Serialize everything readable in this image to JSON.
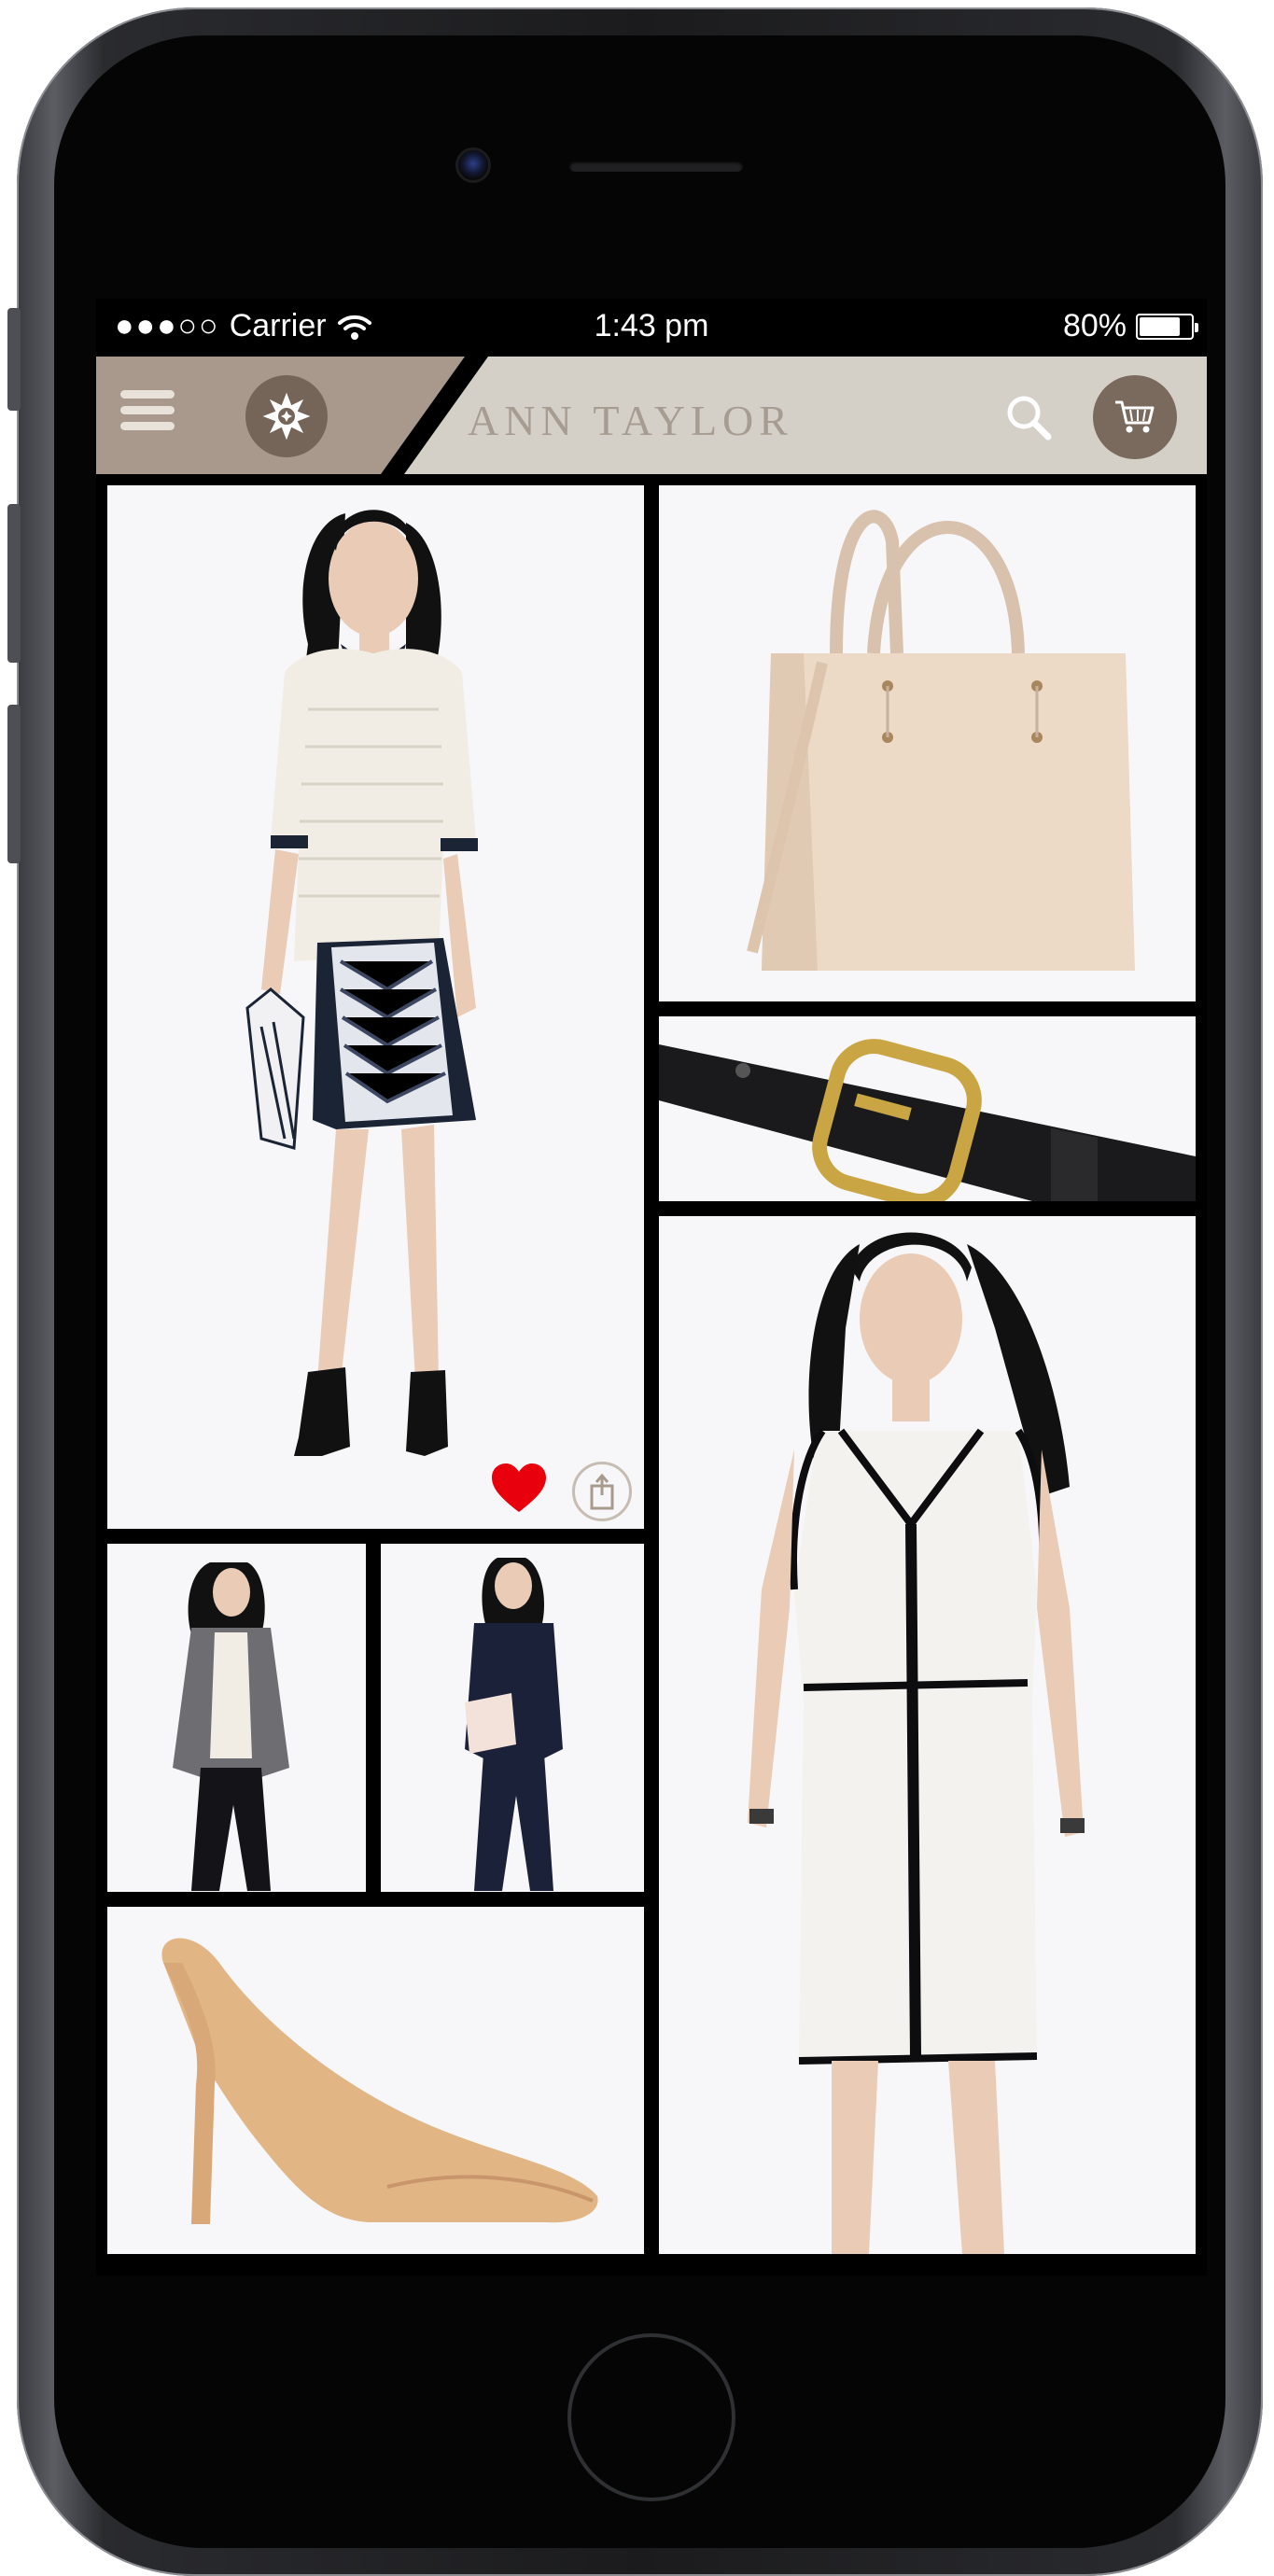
{
  "status_bar": {
    "signal": "●●●○○",
    "carrier": "Carrier",
    "time": "1:43 pm",
    "battery": "80%",
    "battery_level": 0.8
  },
  "nav_bar": {
    "brand": "ANN TAYLOR",
    "menu_icon": "hamburger-menu-icon",
    "feature_icon": "starburst-icon",
    "search_icon": "search-icon",
    "cart_icon": "shopping-cart-icon"
  },
  "grid": {
    "items": [
      {
        "product": "outfit-sweater-skirt"
      },
      {
        "product": "tote-bag"
      },
      {
        "product": "leather-belt"
      },
      {
        "product": "outfit-tweed-jacket"
      },
      {
        "product": "outfit-navy-jumpsuit"
      },
      {
        "product": "nude-heel"
      },
      {
        "product": "white-sheath-dress"
      }
    ]
  },
  "actions": {
    "favorite_icon": "heart-icon",
    "share_icon": "share-icon"
  },
  "colors": {
    "nav_bg": "#d4cfc7",
    "nav_accent": "#a8998c",
    "button_brown": "#7a6a5e",
    "favorite_red": "#e8000d"
  }
}
